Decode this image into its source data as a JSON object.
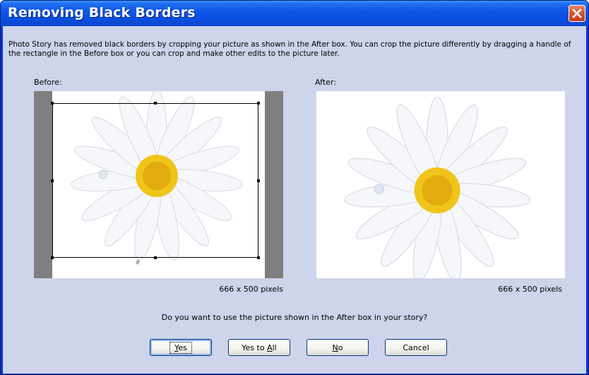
{
  "window": {
    "title": "Removing Black Borders"
  },
  "description": "Photo Story has removed black borders by cropping your picture as shown in the After box. You can crop the picture differently by dragging a handle of the rectangle in the Before box or you can crop and make other edits to the picture later.",
  "before": {
    "label": "Before:",
    "dimensions": "666 x 500 pixels"
  },
  "after": {
    "label": "After:",
    "dimensions": "666 x 500 pixels"
  },
  "question": "Do you want to use the picture shown in the After box in your story?",
  "buttons": {
    "yes": {
      "mnemonic": "Y",
      "rest": "es"
    },
    "yes_to_all": {
      "prefix": "Yes to ",
      "mnemonic": "A",
      "rest": "ll"
    },
    "no": {
      "mnemonic": "N",
      "rest": "o"
    },
    "cancel": {
      "label": "Cancel"
    }
  },
  "icons": {
    "close": "close-icon",
    "image": "daisy-photo"
  },
  "colors": {
    "titlebar": "#0a4fe0",
    "client": "#ced4eb",
    "close": "#d8552f",
    "petal": "#ffffff",
    "center": "#f0c419"
  }
}
